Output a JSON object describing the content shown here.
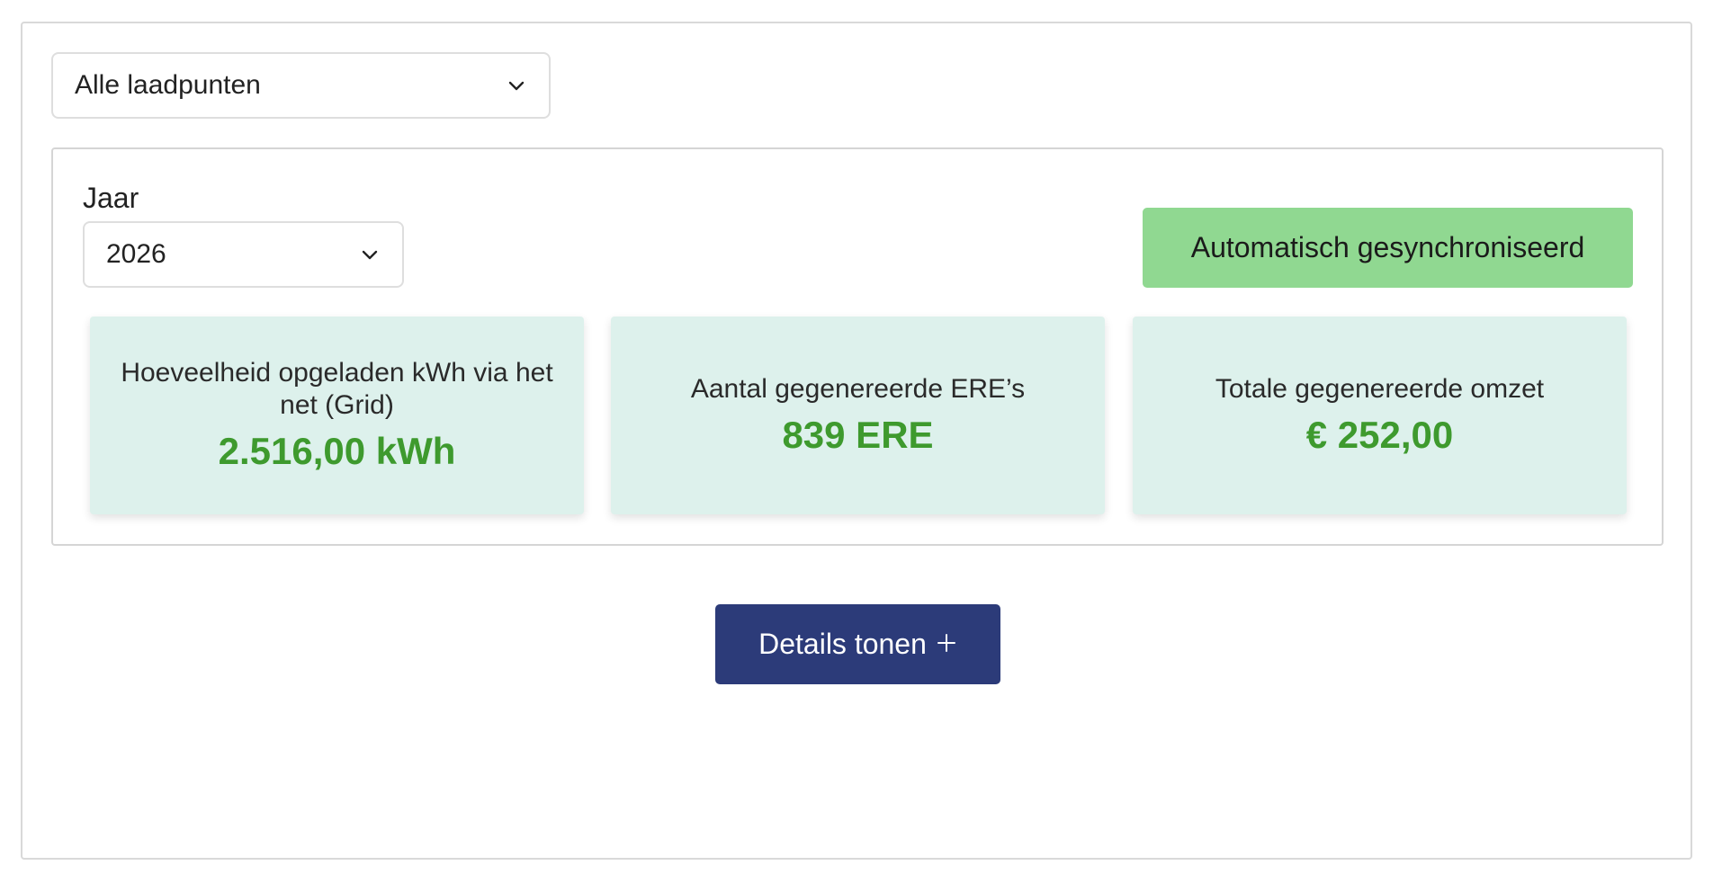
{
  "filters": {
    "charge_point_select": {
      "value": "Alle laadpunten",
      "icon": "chevron-down-icon"
    },
    "year": {
      "label": "Jaar",
      "value": "2026",
      "icon": "chevron-down-icon"
    }
  },
  "sync_status": {
    "label": "Automatisch gesynchroniseerd",
    "color": "#90d891"
  },
  "stats": [
    {
      "label": "Hoeveelheid opgeladen kWh via het net (Grid)",
      "value": "2.516,00 kWh"
    },
    {
      "label": "Aantal gegenereerde ERE’s",
      "value": "839 ERE"
    },
    {
      "label": "Totale gegenereerde omzet",
      "value": "€ 252,00"
    }
  ],
  "actions": {
    "details_label": "Details tonen",
    "details_icon": "plus-icon",
    "button_color": "#2c3b79"
  },
  "colors": {
    "stat_value": "#3e9a2e",
    "stat_card_bg": "#ddf1ec"
  }
}
